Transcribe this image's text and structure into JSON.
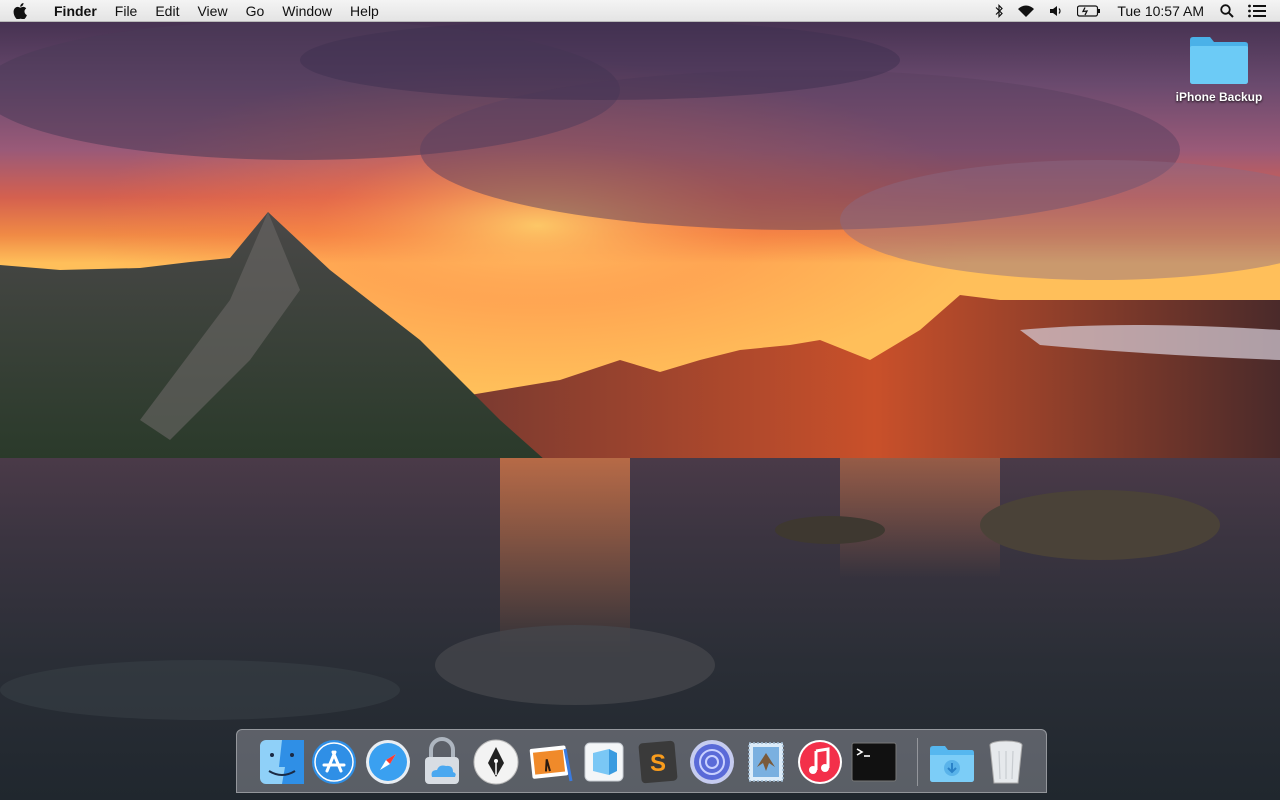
{
  "menubar": {
    "apple_icon": "apple-logo-icon",
    "app_name": "Finder",
    "menus": [
      "File",
      "Edit",
      "View",
      "Go",
      "Window",
      "Help"
    ],
    "status_icons": [
      "bluetooth-icon",
      "wifi-icon",
      "volume-icon",
      "battery-icon"
    ],
    "clock": "Tue 10:57 AM",
    "spotlight_icon": "spotlight-search-icon",
    "notification_icon": "notification-center-icon"
  },
  "desktop": {
    "icons": [
      {
        "label": "iPhone Backup",
        "icon": "folder-icon"
      }
    ]
  },
  "dock": {
    "apps": [
      "Finder",
      "App Store",
      "Safari",
      "Keychain / iCloud",
      "Script Editor",
      "Preview",
      "Xcode",
      "Sublime Text",
      "Network Radar",
      "Mail",
      "iTunes",
      "Terminal",
      "Downloads",
      "Trash"
    ]
  },
  "colors": {
    "menubar": "#ececec",
    "dock_bg": "rgba(210,210,220,0.32)",
    "folder_blue": "#5fc3f3"
  }
}
